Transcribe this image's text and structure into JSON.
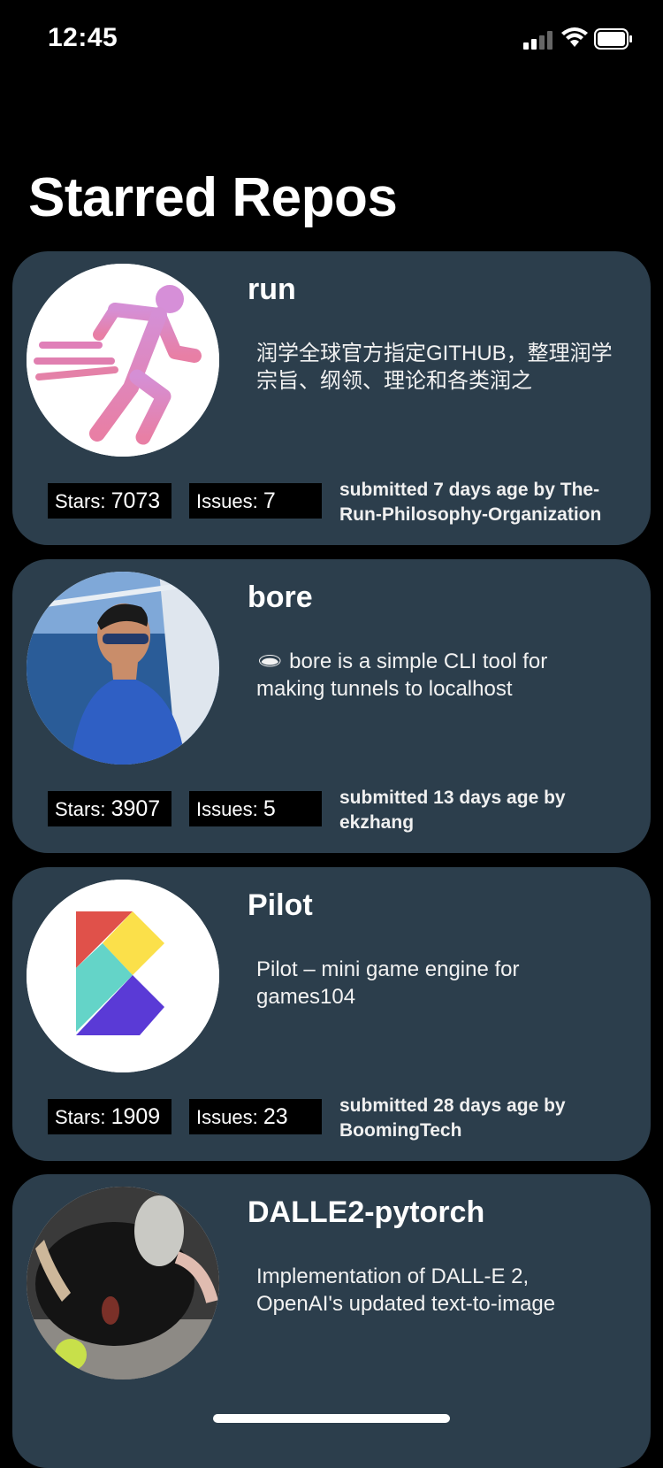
{
  "status_bar": {
    "time": "12:45"
  },
  "page": {
    "title": "Starred Repos"
  },
  "repos": [
    {
      "name": "run",
      "description": "润学全球官方指定GITHUB，整理润学宗旨、纲领、理论和各类润之",
      "stars_label": "Stars: ",
      "stars": "7073",
      "issues_label": "Issues: ",
      "issues": "7",
      "submitted": "submitted 7 days age by The-Run-Philosophy-Organization",
      "avatar_icon": "running-person-icon"
    },
    {
      "name": "bore",
      "description": "🕳 bore is a simple CLI tool for making tunnels to localhost",
      "stars_label": "Stars: ",
      "stars": "3907",
      "issues_label": "Issues: ",
      "issues": "5",
      "submitted": "submitted 13 days age by ekzhang",
      "avatar_icon": "person-photo"
    },
    {
      "name": "Pilot",
      "description": "Pilot – mini game engine for games104",
      "stars_label": "Stars: ",
      "stars": "1909",
      "issues_label": "Issues: ",
      "issues": "23",
      "submitted": "submitted 28 days age by BoomingTech",
      "avatar_icon": "pilot-logo"
    },
    {
      "name": "DALLE2-pytorch",
      "description": "Implementation of DALL-E 2, OpenAI's updated text-to-image",
      "avatar_icon": "dog-photo"
    }
  ],
  "colors": {
    "background": "#000000",
    "card": "#2c3e4c",
    "stat_box": "#000000"
  }
}
